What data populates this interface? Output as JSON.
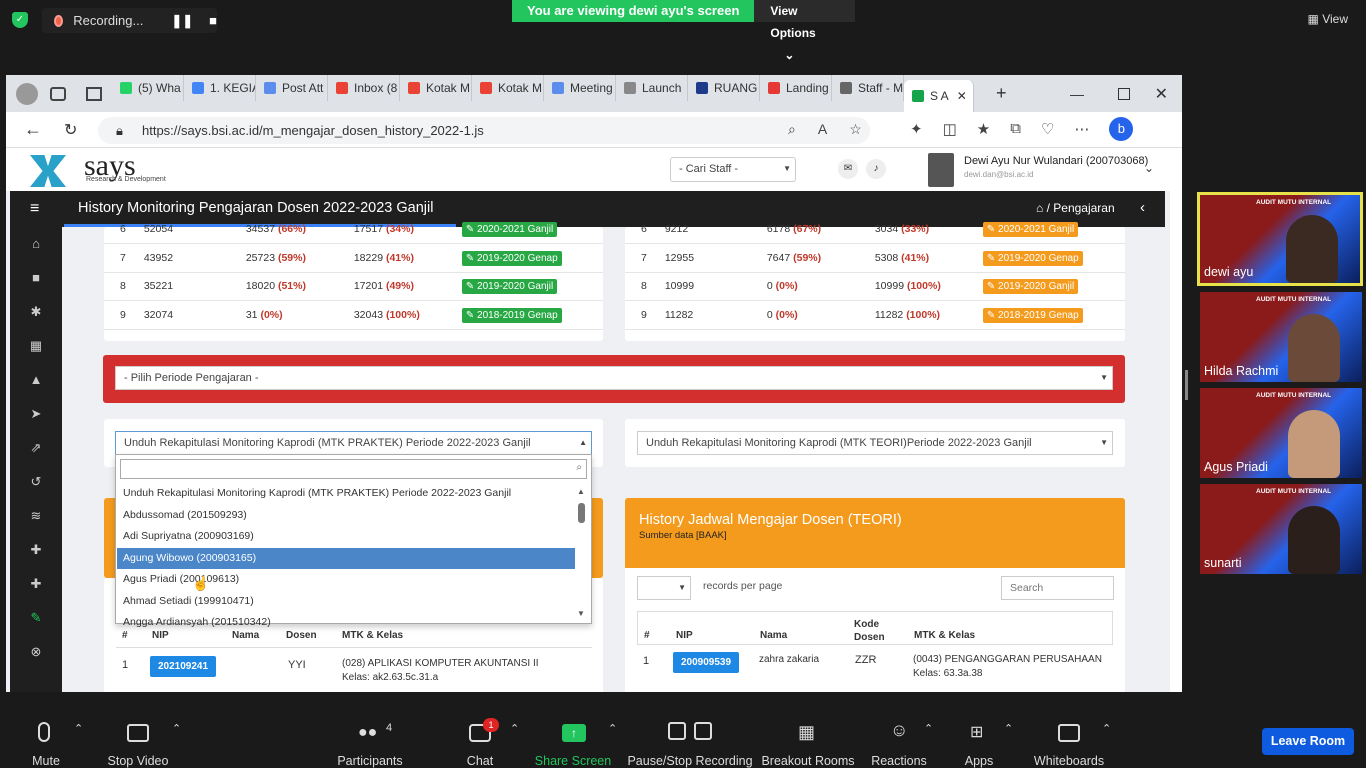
{
  "zoom": {
    "recording": "Recording...",
    "viewing": "You are viewing dewi ayu's screen",
    "view_options": "View Options",
    "view": "View",
    "bottom": {
      "mute": "Mute",
      "stop_video": "Stop Video",
      "participants": "Participants",
      "participants_count": "4",
      "chat": "Chat",
      "chat_badge": "1",
      "share_screen": "Share Screen",
      "pause_rec": "Pause/Stop Recording",
      "breakout": "Breakout Rooms",
      "reactions": "Reactions",
      "apps": "Apps",
      "whiteboards": "Whiteboards",
      "leave": "Leave Room"
    },
    "participants_list": [
      {
        "name": "dewi ayu",
        "banner": "AUDIT MUTU INTERNAL"
      },
      {
        "name": "Hilda Rachmi",
        "banner": "AUDIT MUTU INTERNAL"
      },
      {
        "name": "Agus Priadi",
        "banner": "AUDIT MUTU INTERNAL"
      },
      {
        "name": "sunarti",
        "banner": "AUDIT MUTU INTERNAL"
      }
    ]
  },
  "browser": {
    "tabs": [
      "(5) Wha",
      "1. KEGIA",
      "Post Att",
      "Inbox (8",
      "Kotak M",
      "Kotak M",
      "Meeting",
      "Launch",
      "RUANG",
      "Landing",
      "Staff - M",
      "S A"
    ],
    "url": "https://says.bsi.ac.id/m_mengajar_dosen_history_2022-1.js"
  },
  "header": {
    "logo": "says",
    "logo_sub": "Research & Development",
    "cari_staff": "- Cari Staff -",
    "user_name": "Dewi Ayu Nur Wulandari (200703068)",
    "user_email": "dewi.dan@bsi.ac.id"
  },
  "titlebar": {
    "title": "History Monitoring Pengajaran Dosen 2022-2023 Ganjil",
    "breadcrumb": "Pengajaran"
  },
  "left_rows": [
    {
      "no": "6",
      "a": "52054",
      "b": "34537",
      "bp": "(66%)",
      "c": "17517",
      "cp": "(34%)",
      "badge": "2020-2021 Ganjil"
    },
    {
      "no": "7",
      "a": "43952",
      "b": "25723",
      "bp": "(59%)",
      "c": "18229",
      "cp": "(41%)",
      "badge": "2019-2020 Genap"
    },
    {
      "no": "8",
      "a": "35221",
      "b": "18020",
      "bp": "(51%)",
      "c": "17201",
      "cp": "(49%)",
      "badge": "2019-2020 Ganjil"
    },
    {
      "no": "9",
      "a": "32074",
      "b": "31",
      "bp": "(0%)",
      "c": "32043",
      "cp": "(100%)",
      "badge": "2018-2019 Genap"
    }
  ],
  "right_rows": [
    {
      "no": "6",
      "a": "9212",
      "b": "6178",
      "bp": "(67%)",
      "c": "3034",
      "cp": "(33%)",
      "badge": "2020-2021 Ganjil"
    },
    {
      "no": "7",
      "a": "12955",
      "b": "7647",
      "bp": "(59%)",
      "c": "5308",
      "cp": "(41%)",
      "badge": "2019-2020 Genap"
    },
    {
      "no": "8",
      "a": "10999",
      "b": "0",
      "bp": "(0%)",
      "c": "10999",
      "cp": "(100%)",
      "badge": "2019-2020 Ganjil"
    },
    {
      "no": "9",
      "a": "11282",
      "b": "0",
      "bp": "(0%)",
      "c": "11282",
      "cp": "(100%)",
      "badge": "2018-2019 Genap"
    }
  ],
  "periode": "- Pilih Periode Pengajaran -",
  "unduh_praktek": "Unduh Rekapitulasi Monitoring Kaprodi (MTK PRAKTEK) Periode 2022-2023 Ganjil",
  "unduh_teori": "Unduh Rekapitulasi Monitoring Kaprodi (MTK TEORI)Periode 2022-2023 Ganjil",
  "dropdown_options": [
    "Unduh Rekapitulasi Monitoring Kaprodi (MTK PRAKTEK) Periode 2022-2023 Ganjil",
    "Abdussomad (201509293)",
    "Adi Supriyatna (200903169)",
    "Agung Wibowo (200903165)",
    "Agus Priadi (200109613)",
    "Ahmad Setiadi (199910471)",
    "Angga Ardiansyah (201510342)"
  ],
  "teori": {
    "title": "History Jadwal Mengajar Dosen (TEORI)",
    "sub": "Sumber data [BAAK]",
    "records": "records per page",
    "search": "Search"
  },
  "table_headers": {
    "no": "#",
    "nip": "NIP",
    "nama": "Nama",
    "kode": "Kode Dosen",
    "dosen": "Dosen",
    "mtk": "MTK & Kelas"
  },
  "left_row1": {
    "no": "1",
    "nip": "202109241",
    "kode": "YYI",
    "mtk": "(028) APLIKASI KOMPUTER AKUNTANSI II",
    "kelas": "Kelas: ak2.63.5c.31.a"
  },
  "right_row1": {
    "no": "1",
    "nip": "200909539",
    "nama": "zahra zakaria",
    "kode": "ZZR",
    "mtk": "(0043) PENGANGGARAN PERUSAHAAN",
    "kelas": "Kelas: 63.3a.38"
  }
}
